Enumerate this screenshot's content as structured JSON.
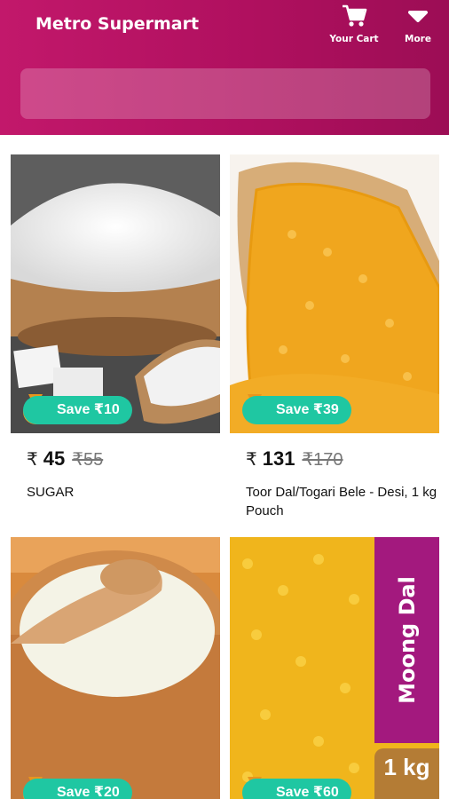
{
  "header": {
    "title": "Metro Supermart",
    "cart_label": "Your Cart",
    "more_label": "More",
    "gradient_colors": [
      "#c2186b",
      "#9c0d55"
    ]
  },
  "search": {
    "value": "",
    "placeholder": ""
  },
  "badge_color": "#1fc7a2",
  "products": [
    {
      "name": "SUGAR",
      "rupee": "₹",
      "price": "45",
      "mrp": "₹55",
      "save": "Save ₹10"
    },
    {
      "name": "Toor Dal/Togari Bele - Desi, 1 kg Pouch",
      "rupee": "₹",
      "price": "131",
      "mrp": "₹170",
      "save": "Save ₹39"
    },
    {
      "name": "",
      "rupee": "",
      "price": "",
      "mrp": "",
      "save": "Save ₹20"
    },
    {
      "name": "",
      "rupee": "",
      "price": "",
      "mrp": "",
      "save": "Save ₹60",
      "image_text": "Moong Dal",
      "image_qty": "1 kg"
    }
  ],
  "icons": {
    "cart": "cart-icon",
    "more": "chevron-down-icon",
    "coin": "rupee-coin-icon"
  }
}
